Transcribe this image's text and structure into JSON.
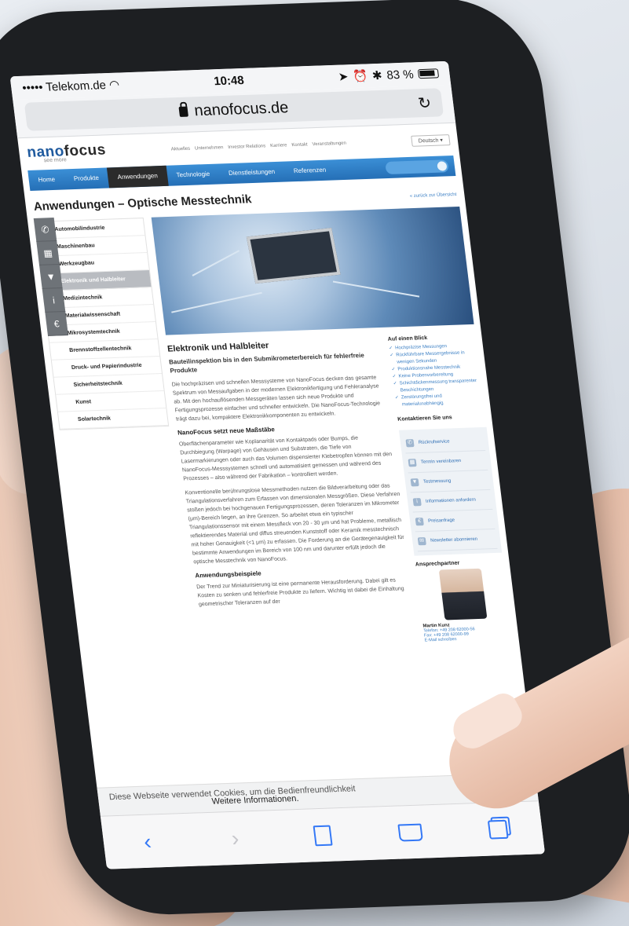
{
  "status_bar": {
    "carrier": "••••• Telekom.de",
    "wifi_icon": "wifi-icon",
    "time": "10:48",
    "battery_percent": "83 %"
  },
  "browser": {
    "url": "nanofocus.de",
    "reload_icon": "reload-icon"
  },
  "site": {
    "logo": "nano",
    "logo_bold": "focus",
    "logo_tagline": "see more",
    "meta_nav": [
      "Aktuelles",
      "Unternehmen",
      "Investor Relations",
      "Karriere",
      "Kontakt",
      "Veranstaltungen"
    ],
    "language": "Deutsch",
    "main_nav": [
      "Home",
      "Produkte",
      "Anwendungen",
      "Technologie",
      "Dienstleistungen",
      "Referenzen"
    ],
    "active_nav": "Anwendungen"
  },
  "page": {
    "title": "Anwendungen – Optische Messtechnik",
    "back_link": "« zurück zur Übersicht"
  },
  "side_menu": [
    "Automobilindustrie",
    "Maschinenbau",
    "Werkzeugbau",
    "Elektronik und Halbleiter",
    "Medizintechnik",
    "Materialwissenschaft",
    "Mikrosystemtechnik",
    "Brennstoffzellentechnik",
    "Druck- und Papierindustrie",
    "Sicherheitstechnik",
    "Kunst",
    "Solartechnik"
  ],
  "side_menu_active": "Elektronik und Halbleiter",
  "article": {
    "heading": "Elektronik und Halbleiter",
    "lead": "Bauteilinspektion bis in den Submikrometerbereich für fehlerfreie Produkte",
    "p1": "Die hochpräzisen und schnellen Messsysteme von NanoFocus decken das gesamte Spektrum von Messaufgaben in der modernen Elektronikfertigung und Fehleranalyse ab. Mit den hochauflösenden Messgeräten lassen sich neue Produkte und Fertigungsprozesse einfacher und schneller entwickeln. Die NanoFocus-Technologie trägt dazu bei, kompaktere Elektronikkomponenten zu entwickeln.",
    "h2": "NanoFocus setzt neue Maßstäbe",
    "p2": "Oberflächenparameter wie Koplanarität von Kontaktpads oder Bumps, die Durchbiegung (Warpage) von Gehäusen und Substraten, die Tiefe von Lasermarkierungen oder auch das Volumen dispensierter Klebetropfen können mit den NanoFocus-Messsystemen schnell und automatisiert gemessen und während des Prozesses – also während der Fabrikation – kontrolliert werden.",
    "p3": "Konventionelle berührungslose Messmethoden nutzen die Bildverarbeitung oder das Triangulationsverfahren zum Erfassen von dimensionalen Messgrößen. Diese Verfahren stoßen jedoch bei hochgenauen Fertigungsprozessen, deren Toleranzen im Mikrometer (µm)-Bereich liegen, an ihre Grenzen. So arbeitet etwa ein typischer Triangulationssensor mit einem Messfleck von 20 - 30 µm und hat Probleme, metallisch reflektierendes Material und diffus streuenden Kunststoff oder Keramik messtechnisch mit hoher Genauigkeit (<1 µm) zu erfassen. Die Forderung an die Gerätegenauigkeit für bestimmte Anwendungen im Bereich von 100 nm und darunter erfüllt jedoch die optische Messtechnik von NanoFocus.",
    "h3": "Anwendungsbeispiele",
    "p4": "Der Trend zur Miniaturisierung ist eine permanente Herausforderung. Dabei gilt es Kosten zu senken und fehlerfreie Produkte zu liefern. Wichtig ist dabei die Einhaltung geometrischer Toleranzen auf der"
  },
  "at_a_glance": {
    "title": "Auf einen Blick",
    "items": [
      "Hochpräzise Messungen",
      "Rückführbare Messergebnisse in wenigen Sekunden",
      "Produktionsnahe Messtechnik",
      "Keine Probenvorbereitung",
      "Schichtdickenmessung transparenter Beschichtungen",
      "Zerstörungsfrei und materialunabhängig"
    ]
  },
  "contact": {
    "title": "Kontaktieren Sie uns",
    "buttons": [
      {
        "label": "Rückrufservice",
        "icon": "phone-icon"
      },
      {
        "label": "Termin vereinbaren",
        "icon": "calendar-icon"
      },
      {
        "label": "Testmessung",
        "icon": "measure-icon"
      },
      {
        "label": "Informationen anfordern",
        "icon": "info-icon"
      },
      {
        "label": "Preisanfrage",
        "icon": "price-icon"
      },
      {
        "label": "Newsletter abonnieren",
        "icon": "newsletter-icon"
      }
    ]
  },
  "partner": {
    "title": "Ansprechpartner",
    "name": "Martin Kunz",
    "phone": "Telefon: +49 208 62000-56",
    "fax": "Fax: +49 208 62000-99",
    "email": "E-Mail schreiben"
  },
  "cookie": {
    "text": "Diese Webseite verwendet Cookies, um die Bedienfreundlichkeit",
    "link": "Weitere Informationen."
  },
  "toolbar": {
    "back_icon": "chevron-left-icon",
    "forward_icon": "chevron-right-icon",
    "share_icon": "share-icon",
    "bookmarks_icon": "bookmarks-icon",
    "tabs_icon": "tabs-icon"
  }
}
